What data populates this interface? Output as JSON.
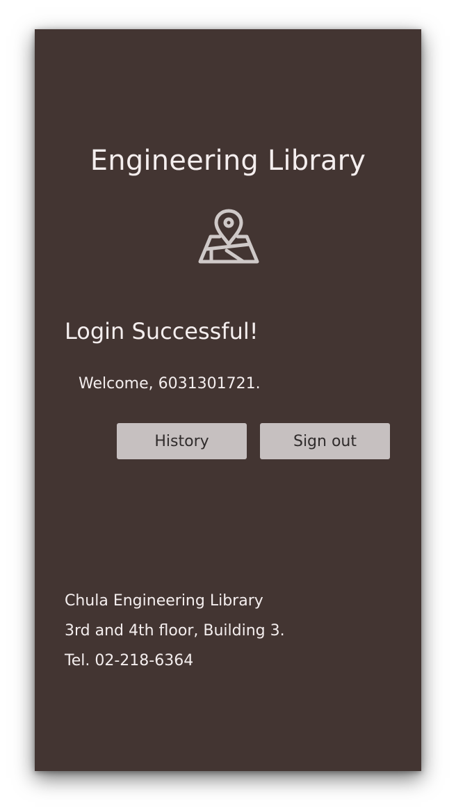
{
  "app": {
    "title": "Engineering Library",
    "icon": "map-pin-icon"
  },
  "login": {
    "heading": "Login Successful!",
    "welcome": "Welcome, 6031301721."
  },
  "actions": {
    "history_label": "History",
    "signout_label": "Sign out"
  },
  "footer": {
    "lines": [
      "Chula Engineering Library",
      "3rd and 4th floor, Building 3.",
      "Tel. 02-218-6364"
    ]
  },
  "colors": {
    "background": "#433532",
    "text": "#f4eeee",
    "button": "#c6c0c0",
    "button_text": "#2f2b2b"
  }
}
